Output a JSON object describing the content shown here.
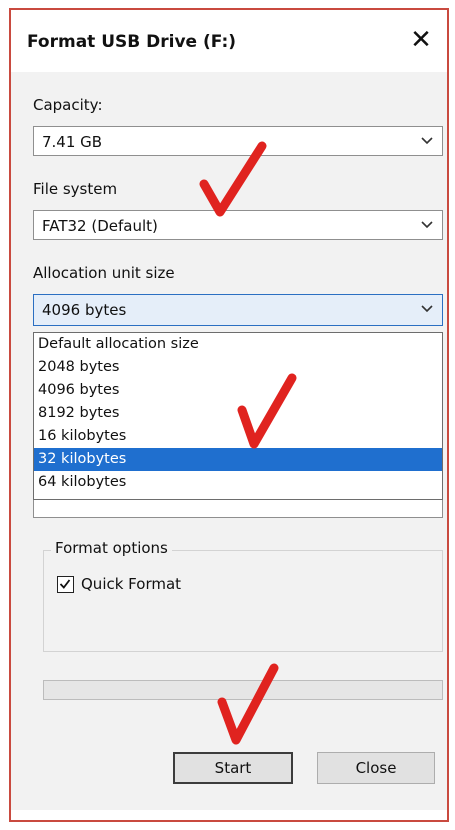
{
  "window": {
    "title": "Format USB Drive (F:)",
    "close_glyph": "✕"
  },
  "capacity": {
    "label": "Capacity:",
    "value": "7.41 GB"
  },
  "file_system": {
    "label": "File system",
    "value": "FAT32 (Default)"
  },
  "allocation": {
    "label": "Allocation unit size",
    "value": "4096 bytes",
    "options": [
      "Default allocation size",
      "2048 bytes",
      "4096 bytes",
      "8192 bytes",
      "16 kilobytes",
      "32 kilobytes",
      "64 kilobytes"
    ],
    "highlighted_option": "32 kilobytes"
  },
  "format_options": {
    "label": "Format options",
    "quick_format_label": "Quick Format",
    "quick_format_checked": true
  },
  "progress": {
    "fraction": 0
  },
  "buttons": {
    "start": "Start",
    "close": "Close"
  },
  "icons": {
    "close": "close-icon",
    "chevron": "chevron-down-icon",
    "check": "checkmark-icon",
    "annotation": "red-checkmark-annotation"
  },
  "colors": {
    "window_border": "#c94a3f",
    "selection": "#1f6fcf",
    "annotation": "#e0231f"
  }
}
